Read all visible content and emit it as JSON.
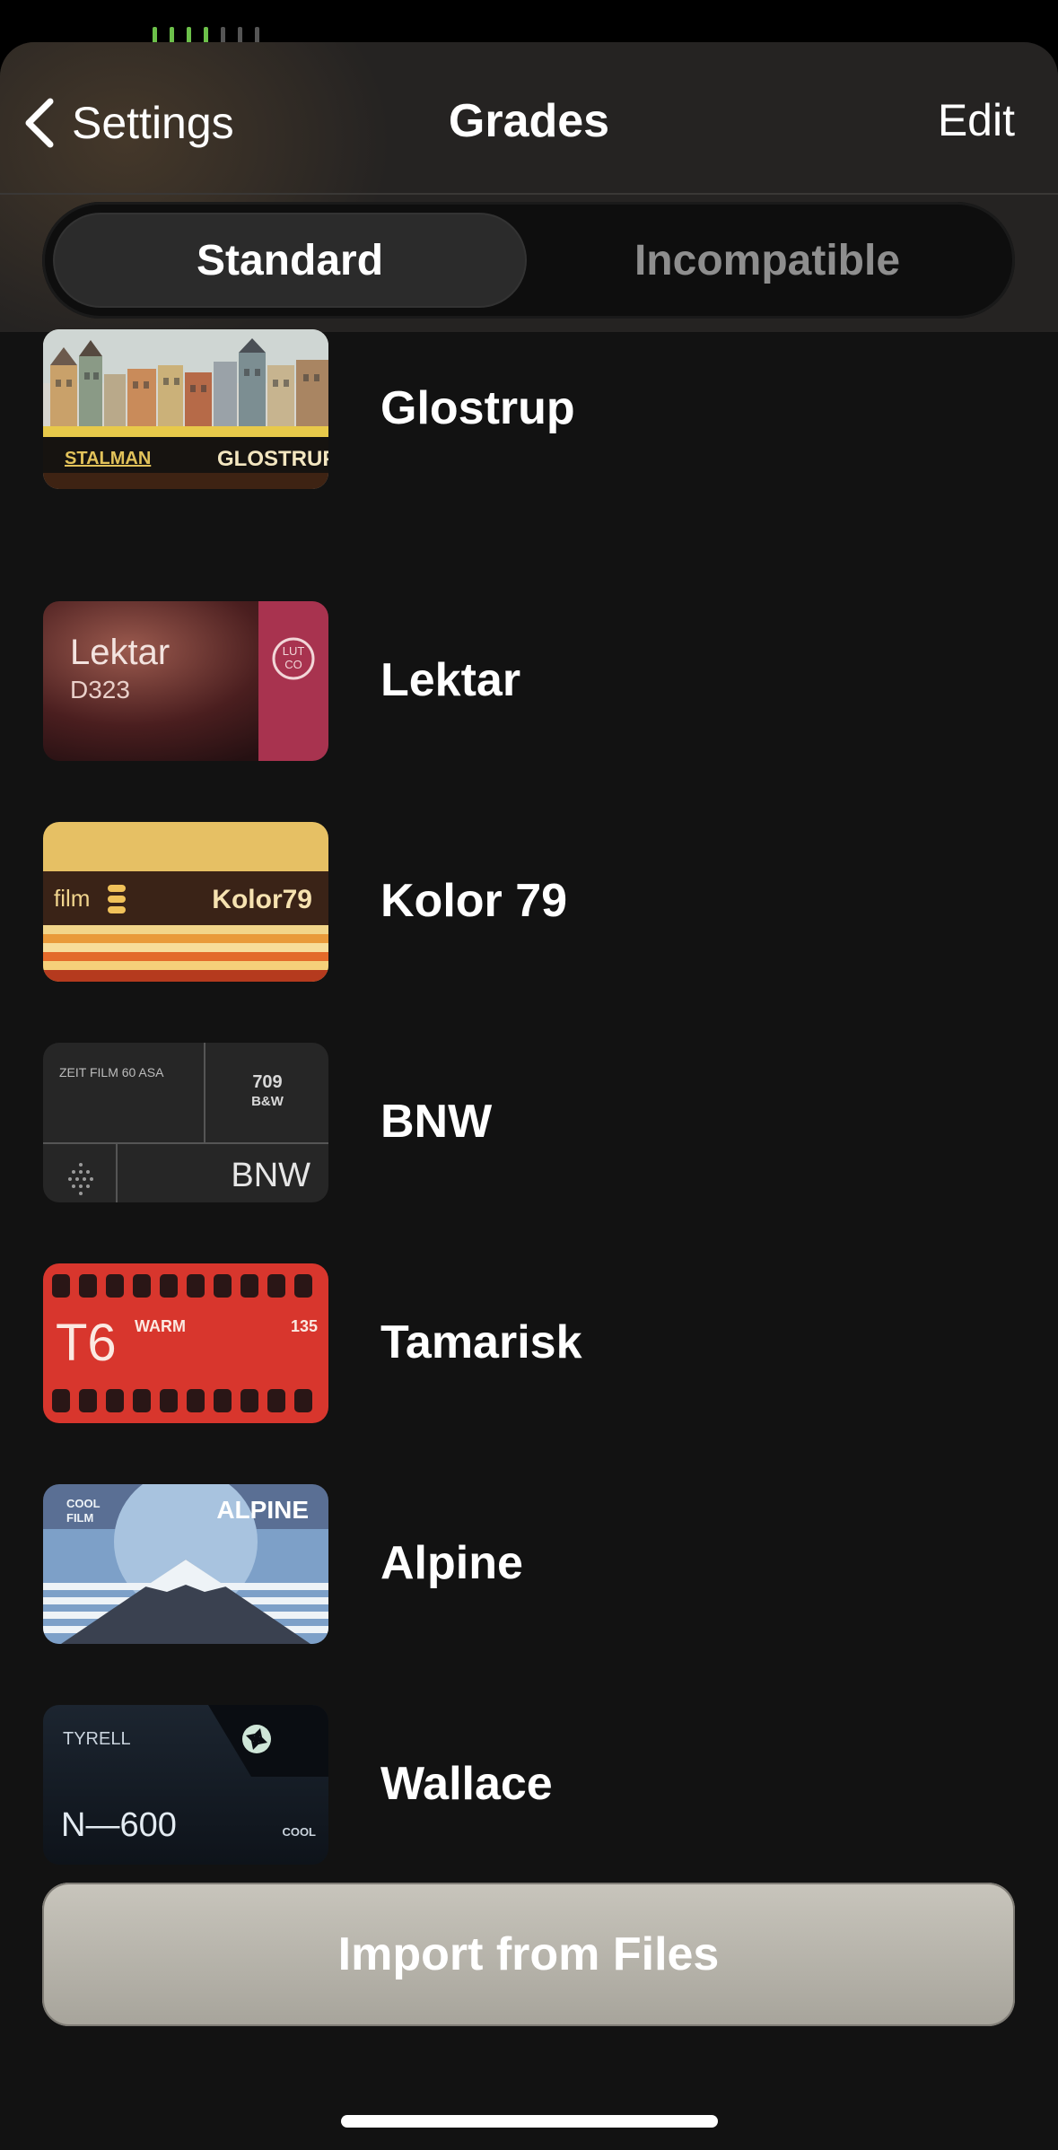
{
  "colors": {
    "sheet_background": "#121212",
    "header_background": "#252322",
    "selected_segment": "#2b2b2b",
    "unselected_segment_text": "#8e8e8e",
    "import_button": "#b8b5ac"
  },
  "nav": {
    "back_icon": "chevron-left-icon",
    "back_label": "Settings",
    "title": "Grades",
    "edit_label": "Edit"
  },
  "segments": {
    "standard": "Standard",
    "incompatible": "Incompatible",
    "selected": "Standard"
  },
  "grades": [
    {
      "name": "Glostrup",
      "thumb": {
        "brand": "STALMAN",
        "title": "GLOSTRUP"
      }
    },
    {
      "name": "Lektar",
      "thumb": {
        "title": "Lektar",
        "code": "D323",
        "badge_top": "LUT",
        "badge_bottom": "CO"
      }
    },
    {
      "name": "Kolor 79",
      "thumb": {
        "prefix": "film",
        "title": "Kolor79"
      }
    },
    {
      "name": "BNW",
      "thumb": {
        "caption": "ZEIT FILM 60 ASA",
        "code": "709",
        "sub": "B&W",
        "title": "BNW"
      }
    },
    {
      "name": "Tamarisk",
      "thumb": {
        "title": "T6",
        "tag": "WARM",
        "number": "135"
      }
    },
    {
      "name": "Alpine",
      "thumb": {
        "line1": "COOL",
        "line2": "FILM",
        "title": "ALPINE"
      }
    },
    {
      "name": "Wallace",
      "thumb": {
        "brand": "TYRELL",
        "title": "N—600",
        "tag": "COOL"
      }
    }
  ],
  "import_label": "Import from Files"
}
